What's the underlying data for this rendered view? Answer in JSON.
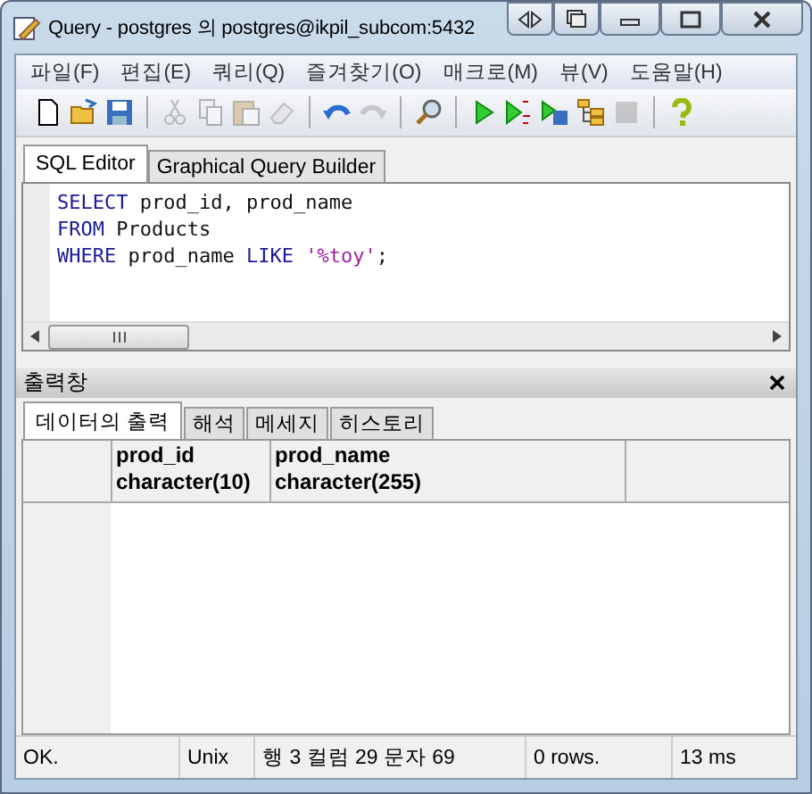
{
  "window": {
    "title": "Query - postgres 의 postgres@ikpil_subcom:5432"
  },
  "menu": [
    "파일(F)",
    "편집(E)",
    "쿼리(Q)",
    "즐겨찾기(O)",
    "매크로(M)",
    "뷰(V)",
    "도움말(H)"
  ],
  "toolbar": [
    {
      "kind": "new",
      "disabled": false
    },
    {
      "kind": "open",
      "disabled": false
    },
    {
      "kind": "save",
      "disabled": false
    },
    {
      "kind": "sep"
    },
    {
      "kind": "cut",
      "disabled": true
    },
    {
      "kind": "copy",
      "disabled": true
    },
    {
      "kind": "paste",
      "disabled": true
    },
    {
      "kind": "eraser",
      "disabled": true
    },
    {
      "kind": "sep"
    },
    {
      "kind": "undo",
      "disabled": false
    },
    {
      "kind": "redo",
      "disabled": true
    },
    {
      "kind": "sep"
    },
    {
      "kind": "find",
      "disabled": false
    },
    {
      "kind": "sep"
    },
    {
      "kind": "run",
      "disabled": false
    },
    {
      "kind": "runpgs",
      "disabled": false
    },
    {
      "kind": "runsave",
      "disabled": false
    },
    {
      "kind": "explain",
      "disabled": false
    },
    {
      "kind": "stop",
      "disabled": true
    },
    {
      "kind": "sep"
    },
    {
      "kind": "help",
      "disabled": false
    }
  ],
  "editor_tabs": [
    {
      "label": "SQL Editor",
      "selected": true
    },
    {
      "label": "Graphical Query Builder",
      "selected": false
    }
  ],
  "code": [
    [
      {
        "kind": "keyword",
        "text": "SELECT"
      },
      {
        "kind": "plain",
        "text": " prod_id, prod_name"
      }
    ],
    [
      {
        "kind": "keyword",
        "text": "FROM"
      },
      {
        "kind": "plain",
        "text": " Products"
      }
    ],
    [
      {
        "kind": "keyword",
        "text": "WHERE"
      },
      {
        "kind": "plain",
        "text": " prod_name "
      },
      {
        "kind": "keyword",
        "text": "LIKE"
      },
      {
        "kind": "string",
        "text": " '%toy'"
      },
      {
        "kind": "plain",
        "text": ";"
      }
    ]
  ],
  "output": {
    "title": "출력창",
    "tabs": [
      {
        "label": "데이터의 출력",
        "selected": true
      },
      {
        "label": "해석",
        "selected": false
      },
      {
        "label": "메세지",
        "selected": false
      },
      {
        "label": "히스토리",
        "selected": false
      }
    ],
    "columns": [
      {
        "name": "prod_id",
        "type": "character(10)"
      },
      {
        "name": "prod_name",
        "type": "character(255)"
      }
    ]
  },
  "status_bar": [
    "OK.",
    "Unix",
    "행 3 컬럼 29 문자 69",
    "0 rows.",
    "13 ms"
  ]
}
